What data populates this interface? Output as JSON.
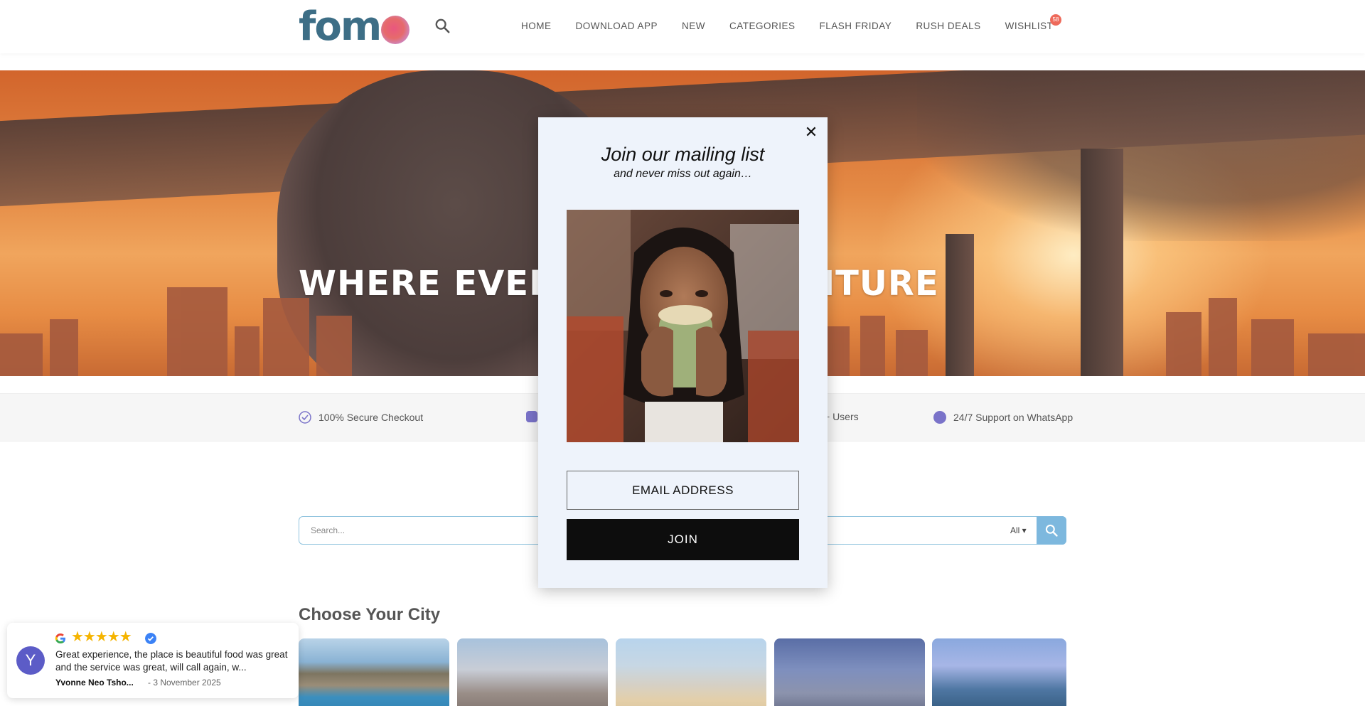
{
  "header": {
    "logo_text": "fom",
    "nav": [
      "HOME",
      "DOWNLOAD APP",
      "NEW",
      "CATEGORIES",
      "FLASH FRIDAY",
      "RUSH DEALS",
      "WISHLIST"
    ],
    "wishlist_count": "58"
  },
  "hero": {
    "title": "WHERE EVERY",
    "title_right": "ENTURE"
  },
  "features": {
    "secure": "100% Secure Checkout",
    "users": "+ Users",
    "support": "24/7 Support on WhatsApp"
  },
  "search": {
    "placeholder": "Search...",
    "filter": "All ▾"
  },
  "cities": {
    "title": "Choose Your City"
  },
  "review": {
    "avatar_letter": "Y",
    "stars": "★★★★★",
    "text": "Great experience, the place is beautiful food was great and the service was great, will call again, w...",
    "author": "Yvonne Neo Tsho...",
    "date": "- 3 November 2025"
  },
  "modal": {
    "title": "Join our mailing list",
    "subtitle": "and never miss out again…",
    "email_placeholder": "EMAIL ADDRESS",
    "join_label": "JOIN",
    "close": "✕"
  },
  "colors": {
    "brand": "#3d6e86",
    "accent": "#ee6a5b",
    "search_button": "#7db8de",
    "modal_bg": "#eef3fb"
  }
}
